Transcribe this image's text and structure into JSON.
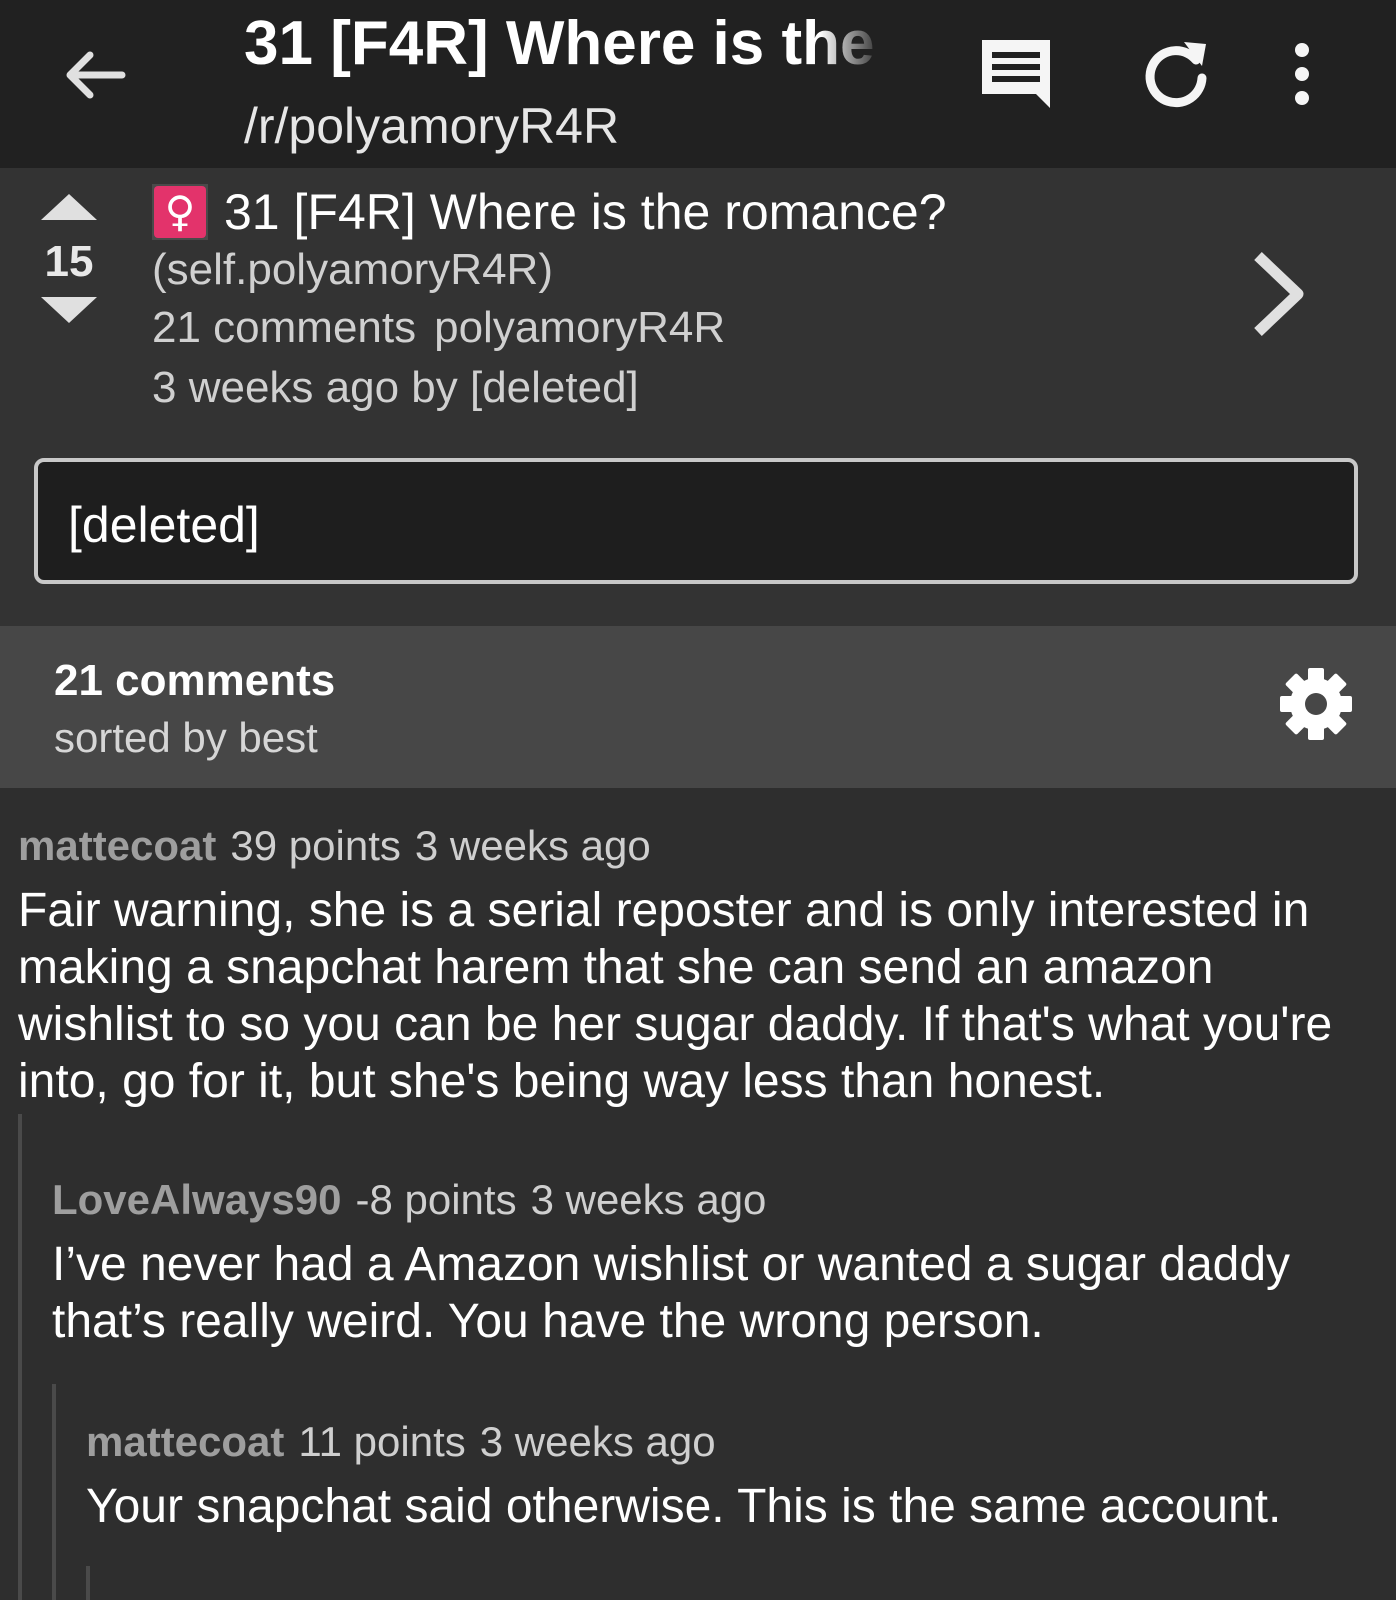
{
  "header": {
    "title": "31 [F4R] Where is the",
    "subreddit": "/r/polyamoryR4R"
  },
  "post": {
    "score": "15",
    "flair_glyph": "♀",
    "title": "31 [F4R] Where is the romance?",
    "domain": "(self.polyamoryR4R)",
    "comments": "21 comments",
    "subreddit": "polyamoryR4R",
    "age": "3 weeks ago by [deleted]",
    "selftext": "[deleted]"
  },
  "comments_header": {
    "count": "21 comments",
    "sort": "sorted by best"
  },
  "comments": [
    {
      "author": "mattecoat",
      "points": "39 points",
      "age": "3 weeks ago",
      "body": "Fair warning, she is a serial reposter and is only interested in making a snapchat harem that she can send an amazon wishlist to so you can be her sugar daddy. If that's what you're into, go for it, but she's being way less than honest."
    },
    {
      "author": "LoveAlways90",
      "points": "-8 points",
      "age": "3 weeks ago",
      "body": "I’ve never had a Amazon wishlist or wanted a sugar daddy that’s really weird. You have the wrong person."
    },
    {
      "author": "mattecoat",
      "points": "11 points",
      "age": "3 weeks ago",
      "body": "Your snapchat said otherwise. This is the same account."
    }
  ]
}
